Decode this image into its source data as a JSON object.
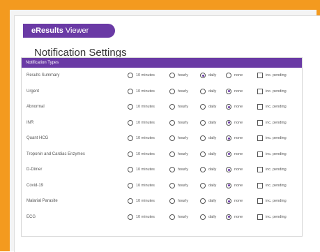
{
  "app": {
    "brand_bold": "eResults",
    "brand_rest": " Viewer"
  },
  "page": {
    "title": "Notification Settings"
  },
  "panel": {
    "header": "Notification Types"
  },
  "options": {
    "ten_minutes": "10 minutes",
    "hourly": "hourly",
    "daily": "daily",
    "none": "none",
    "inc_pending": "inc. pending"
  },
  "rows": [
    {
      "label": "Results Summary",
      "selected": "daily"
    },
    {
      "label": "Urgent",
      "selected": "none"
    },
    {
      "label": "Abnormal",
      "selected": "none"
    },
    {
      "label": "INR",
      "selected": "none"
    },
    {
      "label": "Quant HCG",
      "selected": "none"
    },
    {
      "label": "Troponin and Cardiac Enzymes",
      "selected": "none"
    },
    {
      "label": "D-Dimer",
      "selected": "none"
    },
    {
      "label": "Covid-19",
      "selected": "none"
    },
    {
      "label": "Malarial Parasite",
      "selected": "none"
    },
    {
      "label": "ECG",
      "selected": "none"
    }
  ],
  "colors": {
    "accent": "#6a3aa5",
    "frame": "#f39a1f"
  }
}
